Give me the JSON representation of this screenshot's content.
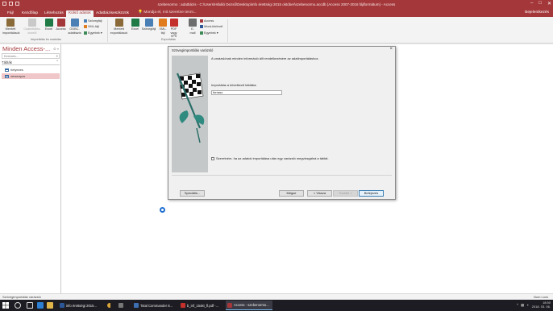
{
  "window": {
    "title": "szebenormo : adatbázis - C:\\Users\\Hibáló Dezső\\Desktop\\info érettségi 2015 október\\szebenormo.accdb (Access 2007-2016 fájlformátum) - Access",
    "controls": {
      "minimize": "–",
      "restore": "□",
      "close": "✕"
    }
  },
  "tabs": {
    "items": [
      "Fájl",
      "Kezdőlap",
      "Létrehozás",
      "Külső adatok",
      "Adatbáziseszközök"
    ],
    "active": "Külső adatok",
    "tell_me": "Mondja el, mit szeretne tenni...",
    "user": "Bejelentkezés"
  },
  "ribbon": {
    "import": {
      "saved_imports": "Mentett importálások",
      "linked_table_manager": "Csatolttábla-kezelő",
      "excel": "Excel",
      "access": "Access",
      "odbc": "ODBC-adatbázis",
      "text_file": "Szövegfájl",
      "xml_file": "XML-fájl",
      "more": "Egyebek",
      "group_label": "Importálás és csatolás"
    },
    "export": {
      "saved_exports": "Mentett exportálások",
      "excel": "Excel",
      "text_file": "Szövegfájl",
      "xml_file": "XML-fájl",
      "pdf_xps": "PDF vagy XPS",
      "email": "E-mail",
      "access": "Access",
      "word_merge": "Word-körlevél",
      "more": "Egyebek",
      "group_label": "Exportálás"
    }
  },
  "nav": {
    "title": "Minden Access-...",
    "search_placeholder": "Keresés...",
    "group": "Táblák",
    "items": [
      "helyezes",
      "versenyzo"
    ]
  },
  "dialog": {
    "title": "Szövegimportálás varázsló",
    "message": "A varázslónak minden információ állt rendelkezésére az adatimportáláshoz.",
    "field_label": "Importálás a következő táblába:",
    "field_value": "forrasz",
    "checkbox_label": "Szeretném, ha az adatok importálása után egy varázsló megvizsgálná a táblát.",
    "buttons": {
      "advanced": "Speciális...",
      "cancel": "Mégse",
      "back": "< Vissza",
      "next": "Tovább >",
      "finish": "Befejezés"
    }
  },
  "status": {
    "left": "Szövegimportálás varázsló",
    "right": "Num Lock"
  },
  "taskbar": {
    "apps": [
      "info érettségi 2015...",
      "Total Commander 8...",
      "b_inf_15okt_fl.pdf -...",
      "Access - szebenormo..."
    ],
    "time": "18:50",
    "date": "2018. 03. 06."
  }
}
